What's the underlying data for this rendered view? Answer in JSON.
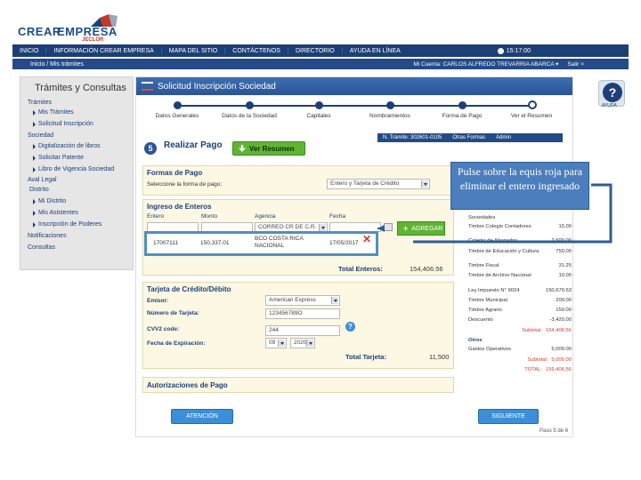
{
  "brand": {
    "name_part1": "CREAR",
    "name_part2": "EMPRESA",
    "sub": "JECLOR"
  },
  "topnav": {
    "items": [
      "INICIO",
      "INFORMACIÓN CREAR EMPRESA",
      "MAPA DEL SITIO",
      "CONTÁCTENOS",
      "DIRECTORIO",
      "AYUDA EN LÍNEA"
    ],
    "clock": "15:17:00"
  },
  "subnav": {
    "crumb": "Inicio / Mis trámites",
    "user": "Mi Cuenta: CARLOS ALFREDO TREVARRIA ABARCA ▾",
    "logout": "Salir ×"
  },
  "sidebar": {
    "title": "Trámites y Consultas",
    "sections": [
      "Trámites",
      "Sociedad",
      "Aval Legal",
      "Notificaciones",
      "Consultas"
    ],
    "items": [
      {
        "section": "Trámites",
        "label": "Mis Trámites"
      },
      {
        "section": "Trámites",
        "label": "Solicitud Inscripción"
      },
      {
        "section": "Sociedad",
        "label": "Digitalización de libros"
      },
      {
        "section": "Sociedad",
        "label": "Solicitar Patente"
      },
      {
        "section": "Sociedad",
        "label": "Libro de Vigencia Sociedad"
      },
      {
        "section": "Distrito",
        "label": "Mi Distrito"
      },
      {
        "section": "Distrito",
        "label": "Mis Asistentes"
      },
      {
        "section": "Distrito",
        "label": "Inscripción de Poderes"
      }
    ],
    "distrito": "Distrito"
  },
  "help": {
    "symbol": "?",
    "label": "AYUDA"
  },
  "main": {
    "title": "Solicitud Inscripción Sociedad",
    "steps": [
      {
        "label": "Datos Generales",
        "done": true
      },
      {
        "label": "Datos de la Sociedad",
        "done": true
      },
      {
        "label": "Capitales",
        "done": true
      },
      {
        "label": "Nombramientos",
        "done": true
      },
      {
        "label": "Forma de Pago",
        "done": true
      },
      {
        "label": "Ver el Resumen",
        "done": false
      }
    ],
    "tramite": {
      "numero": "N. Trámite: 302601-0105",
      "estado": "Otras Formas",
      "admin": "Admin"
    },
    "step_number": "5",
    "realizar_pago": "Realizar Pago",
    "ver_resumen": "Ver Resumen"
  },
  "formas_pago": {
    "title": "Formas de Pago",
    "select_label": "Seleccione la forma de pago:",
    "select_value": "Entero y Tarjeta de Crédito"
  },
  "ingreso_enteros": {
    "title": "Ingreso de Enteros",
    "columns": [
      "Entero",
      "Monto",
      "Agencia",
      "Fecha"
    ],
    "agencia_input": "CORREO CR DE C.R.",
    "agregar": "AGREGAR",
    "row": {
      "entero": "17007111",
      "monto": "150,337.01",
      "agencia": "BCO COSTA RICA NACIONAL",
      "fecha": "17/05/2017"
    },
    "total_label": "Total Enteros:",
    "total_value": "154,406.56"
  },
  "tarjeta": {
    "title": "Tarjeta de Crédito/Débito",
    "emisor_label": "Emisor:",
    "emisor_value": "American Express",
    "numero_label": "Número de Tarjeta:",
    "numero_value": "123456789O",
    "cvv_label": "CVV2 code:",
    "cvv_value": "244",
    "exp_label": "Fecha de Expiración:",
    "exp_month": "09",
    "exp_year": "2020",
    "total_label": "Total Tarjeta:",
    "total_value": "11,500"
  },
  "autorizaciones": {
    "title": "Autorizaciones de Pago"
  },
  "callout": "Pulse sobre la  equis roja para eliminar el entero ingresado",
  "summary": {
    "rows": [
      {
        "label": "Sociedades",
        "value": ""
      },
      {
        "label": "Timbre Colegio Contadores",
        "value": "15.00"
      },
      {
        "label": "Colegio de Abogados",
        "value": "2,500.00"
      },
      {
        "label": "Timbre de Educación y Cultura",
        "value": "750.00"
      },
      {
        "label": "Timbre Fiscal",
        "value": "31.25"
      },
      {
        "label": "Timbre de Archivo Nacional",
        "value": "10.00"
      },
      {
        "label": "Ley Impuesto N° 9024",
        "value": "150,670.63"
      },
      {
        "label": "Timbre Municipal",
        "value": "200.00"
      },
      {
        "label": "Timbre Agrario",
        "value": "150.00"
      },
      {
        "label": "Descuento",
        "value": "-3,420.00"
      }
    ],
    "subtotal1_label": "Subtotal:",
    "subtotal1_value": "154,406.56",
    "otros_label": "Otros",
    "gastos_label": "Gastos Operativos",
    "gastos_value": "5,000.00",
    "subtotal2_label": "Subtotal:",
    "subtotal2_value": "5,000.00",
    "total_label": "TOTAL:",
    "total_value": "159,406.56"
  },
  "footer": {
    "atencion": "ATENCIÓN",
    "siguiente": "SIGUIENTE",
    "page": "Paso 5 de 6"
  }
}
